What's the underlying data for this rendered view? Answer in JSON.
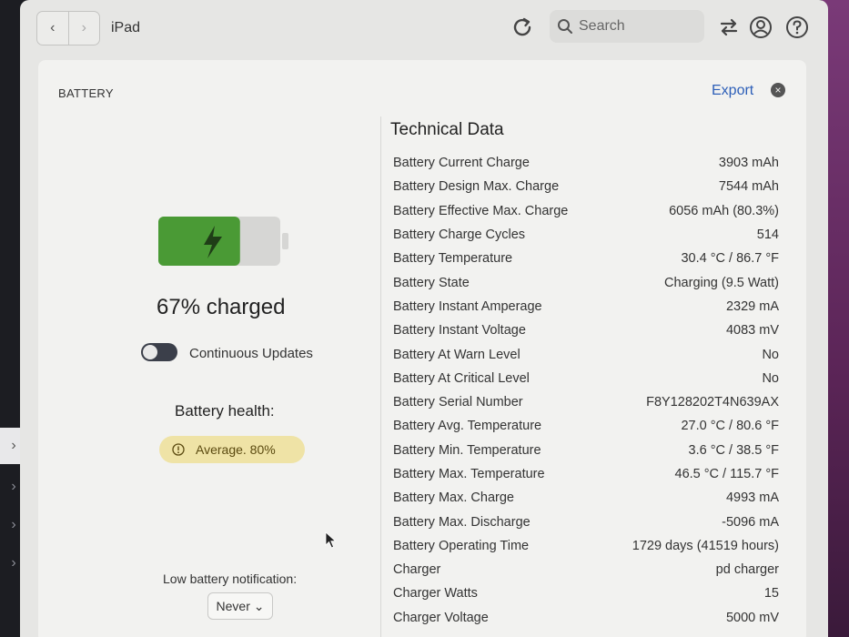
{
  "toolbar": {
    "back_label": "‹",
    "forward_label": "›",
    "device_title": "iPad",
    "search_placeholder": "Search"
  },
  "header": {
    "section_label": "BATTERY",
    "export_label": "Export",
    "close_glyph": "×"
  },
  "battery": {
    "charge_text": "67% charged",
    "charge_level": 0.67,
    "continuous_updates_label": "Continuous Updates",
    "continuous_updates_on": false,
    "health_title": "Battery health:",
    "health_badge": "Average. 80%",
    "low_battery_label": "Low battery notification:",
    "low_battery_value": "Never ⌄"
  },
  "technical_data": {
    "title": "Technical Data",
    "rows": [
      {
        "label": "Battery Current Charge",
        "value": "3903 mAh"
      },
      {
        "label": "Battery Design Max. Charge",
        "value": "7544 mAh"
      },
      {
        "label": "Battery Effective Max. Charge",
        "value": "6056 mAh (80.3%)"
      },
      {
        "label": "Battery Charge Cycles",
        "value": "514"
      },
      {
        "label": "Battery Temperature",
        "value": "30.4 °C / 86.7 °F"
      },
      {
        "label": "Battery State",
        "value": "Charging (9.5 Watt)"
      },
      {
        "label": "Battery Instant Amperage",
        "value": "2329 mA"
      },
      {
        "label": "Battery Instant Voltage",
        "value": "4083 mV"
      },
      {
        "label": "Battery At Warn Level",
        "value": "No"
      },
      {
        "label": "Battery At Critical Level",
        "value": "No"
      },
      {
        "label": "Battery Serial Number",
        "value": "F8Y128202T4N639AX"
      },
      {
        "label": "Battery Avg. Temperature",
        "value": "27.0 °C / 80.6 °F"
      },
      {
        "label": "Battery Min. Temperature",
        "value": "3.6 °C / 38.5 °F"
      },
      {
        "label": "Battery Max. Temperature",
        "value": "46.5 °C / 115.7 °F"
      },
      {
        "label": "Battery Max. Charge",
        "value": "4993 mA"
      },
      {
        "label": "Battery Max. Discharge",
        "value": "-5096 mA"
      },
      {
        "label": "Battery Operating Time",
        "value": "1729 days (41519 hours)"
      },
      {
        "label": "Charger",
        "value": "pd charger"
      },
      {
        "label": "Charger Watts",
        "value": "15"
      },
      {
        "label": "Charger Voltage",
        "value": "5000 mV"
      }
    ]
  },
  "sidebar": {
    "chevron_glyph": "›"
  },
  "colors": {
    "battery_fill": "#4a9a35",
    "battery_empty": "#d6d6d4",
    "export_link": "#2d5fb8",
    "badge_bg": "#efe3a6"
  }
}
